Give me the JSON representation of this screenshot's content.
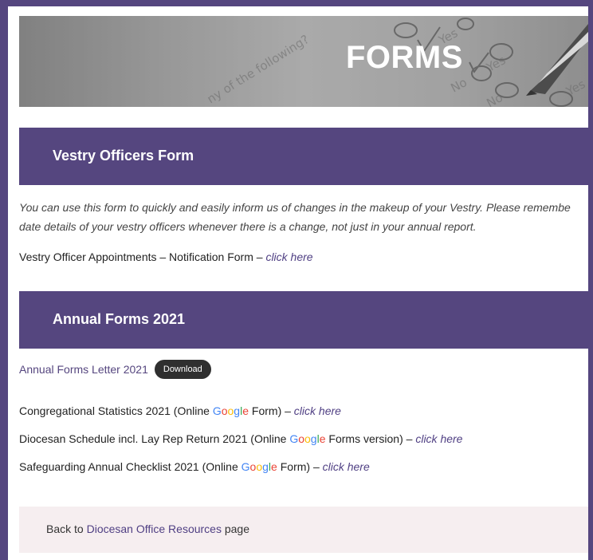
{
  "hero": {
    "title": "FORMS"
  },
  "vestry": {
    "header": "Vestry Officers Form",
    "intro_line1": "You can use this form to quickly and easily inform us of changes in the makeup of your Vestry. Please remembe",
    "intro_line2": "date details of your vestry officers whenever there is a change, not just in your annual report.",
    "form_text": "Vestry Officer Appointments – Notification Form – ",
    "form_link": "click here"
  },
  "annual": {
    "header": "Annual Forms 2021",
    "letter_label": "Annual Forms Letter 2021",
    "download_label": "Download",
    "google": [
      "G",
      "o",
      "o",
      "g",
      "l",
      "e"
    ],
    "congregational": {
      "before": "Congregational Statistics 2021 (Online ",
      "after": " Form) – ",
      "link": "click here"
    },
    "diocesan": {
      "before": "Diocesan Schedule incl. Lay Rep Return 2021 (Online ",
      "after": " Forms version) – ",
      "link": "click here"
    },
    "safeguarding": {
      "before": "Safeguarding Annual Checklist 2021 (Online ",
      "after": " Form) – ",
      "link": "click here"
    }
  },
  "footer": {
    "back_prefix": "Back to ",
    "back_link": "Diocesan Office Resources",
    "back_suffix": " page"
  },
  "colors": {
    "brand": "#55467f",
    "link": "#4f3f83",
    "back_box": "#f6eef0",
    "button": "#2f2f2f"
  },
  "icons": {
    "hero_image": "checkbox-survey-pen-image"
  }
}
